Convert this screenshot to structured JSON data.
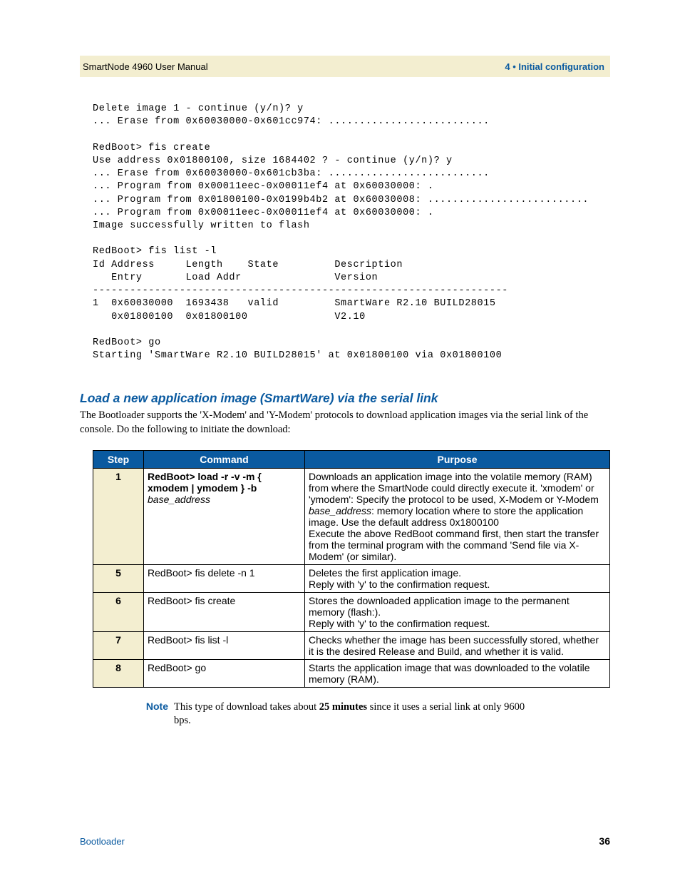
{
  "header": {
    "doc_title": "SmartNode 4960 User Manual",
    "chapter": "4 • Initial configuration"
  },
  "console_block": "Delete image 1 - continue (y/n)? y\n... Erase from 0x60030000-0x601cc974: ..........................\n\nRedBoot> fis create\nUse address 0x01800100, size 1684402 ? - continue (y/n)? y\n... Erase from 0x60030000-0x601cb3ba: ..........................\n... Program from 0x00011eec-0x00011ef4 at 0x60030000: .\n... Program from 0x01800100-0x0199b4b2 at 0x60030008: ..........................\n... Program from 0x00011eec-0x00011ef4 at 0x60030000: .\nImage successfully written to flash\n\nRedBoot> fis list -l\nId Address     Length    State         Description\n   Entry       Load Addr               Version\n-------------------------------------------------------------------\n1  0x60030000  1693438   valid         SmartWare R2.10 BUILD28015\n   0x01800100  0x01800100              V2.10\n\nRedBoot> go\nStarting 'SmartWare R2.10 BUILD28015' at 0x01800100 via 0x01800100",
  "section": {
    "title": "Load a new application image (SmartWare) via the serial link",
    "para": "The Bootloader supports the 'X-Modem' and 'Y-Modem' protocols to download application images via the serial link of the console. Do the following to initiate the download:"
  },
  "table": {
    "headers": {
      "step": "Step",
      "command": "Command",
      "purpose": "Purpose"
    },
    "rows": [
      {
        "step": "1",
        "cmd_bold": "RedBoot> load -r -v -m { xmodem | ymodem } -b",
        "cmd_ital": "base_address",
        "purpose_pre": "Downloads an application image into the volatile memory (RAM) from where the SmartNode could directly execute it. 'xmodem' or 'ymodem': Specify the protocol to be used, X-Modem or Y-Modem",
        "purpose_ital": "base_address",
        "purpose_post": ": memory location where to store the application image. Use the default address 0x1800100\nExecute the above RedBoot command first, then start the transfer from the terminal program with the command 'Send file via X-Modem' (or similar)."
      },
      {
        "step": "5",
        "cmd": "RedBoot> fis delete -n 1",
        "purpose": "Deletes the first application image.\nReply with 'y' to the confirmation request."
      },
      {
        "step": "6",
        "cmd": "RedBoot> fis create",
        "purpose": "Stores the downloaded application image to the permanent memory (flash:).\nReply with 'y' to the confirmation request."
      },
      {
        "step": "7",
        "cmd": "RedBoot> fis list -l",
        "purpose": "Checks whether the image has been successfully stored, whether it is the desired Release and Build, and whether it is valid."
      },
      {
        "step": "8",
        "cmd": "RedBoot> go",
        "purpose": "Starts the application image that was downloaded to the volatile memory (RAM)."
      }
    ]
  },
  "note": {
    "label": "Note",
    "text_pre": "This type of download takes about ",
    "text_bold": "25 minutes",
    "text_post": " since it uses a serial link at only 9600 bps."
  },
  "footer": {
    "left": "Bootloader",
    "right": "36"
  }
}
